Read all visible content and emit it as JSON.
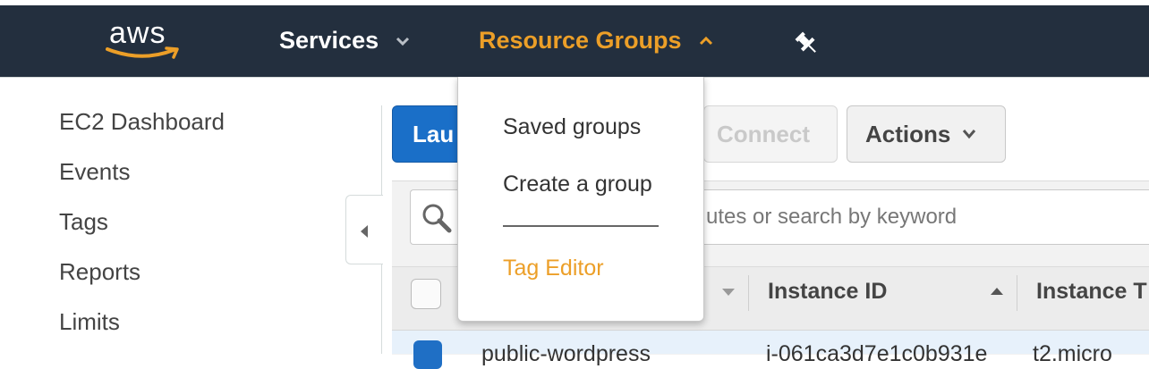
{
  "navbar": {
    "logo_text": "aws",
    "services_label": "Services",
    "resource_groups_label": "Resource Groups",
    "accent_color": "#ec9f28",
    "background_color": "#232f3e"
  },
  "sidebar": {
    "items": [
      {
        "label": "EC2 Dashboard"
      },
      {
        "label": "Events"
      },
      {
        "label": "Tags"
      },
      {
        "label": "Reports"
      },
      {
        "label": "Limits"
      }
    ]
  },
  "toolbar": {
    "launch_label": "Lau",
    "connect_label": "Connect",
    "actions_label": "Actions"
  },
  "search": {
    "placeholder_visible": "utes or search by keyword"
  },
  "table": {
    "headers": [
      "Instance ID",
      "Instance T"
    ],
    "row": {
      "name": "public-wordpress",
      "instance_id": "i-061ca3d7e1c0b931e",
      "type": "t2.micro"
    }
  },
  "resource_groups_menu": {
    "items": [
      {
        "label": "Saved groups"
      },
      {
        "label": "Create a group"
      },
      {
        "label": "Tag Editor"
      }
    ]
  },
  "icons": {
    "services_caret": "chevron-down-icon",
    "resource_groups_caret": "chevron-up-icon",
    "pin": "pin-icon",
    "search": "search-icon",
    "collapse": "collapse-left-icon"
  }
}
